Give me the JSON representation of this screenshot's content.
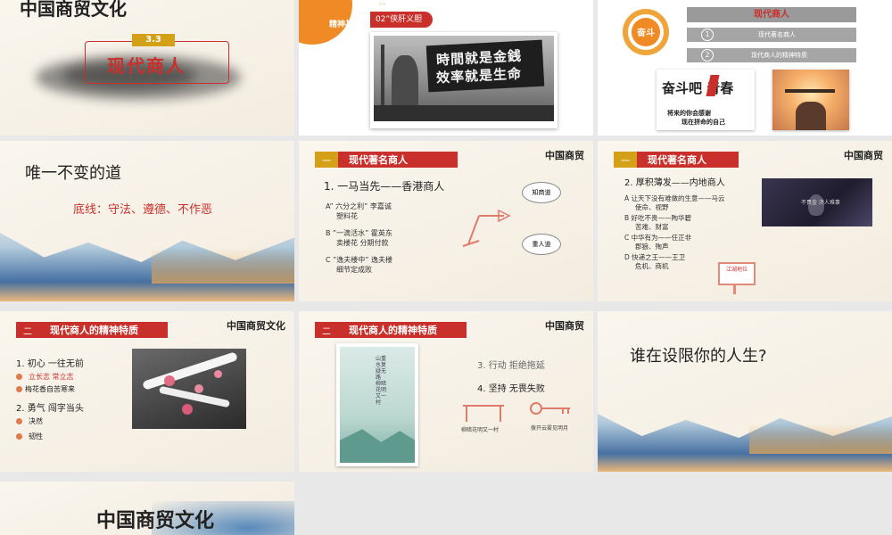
{
  "colors": {
    "red": "#c9302c",
    "gold": "#d4a017",
    "orange": "#f08a24",
    "gray": "#9a9a9a"
  },
  "s1": {
    "logo": "中国商贸文化",
    "badge": "3.3",
    "title": "现代商人"
  },
  "s2": {
    "tab_small": "…",
    "tab_label": "精神基础",
    "section": "02”侠肝义胆",
    "photo_line1": "時間就是金銭",
    "photo_line2": "效率就是生命"
  },
  "s3": {
    "circle_label": "奋斗",
    "menu_title": "现代商人",
    "item1_num": "1",
    "item1": "现代著名商人",
    "item2_num": "2",
    "item2": "现代商人的精神特质",
    "poster_title": "奋斗吧 青春",
    "poster_sub1": "将来的你会感谢",
    "poster_sub2": "现在拼命的自己"
  },
  "s4": {
    "title": "唯一不变的道",
    "subtitle": "底线：守法、遵德、不作恶"
  },
  "s5": {
    "hdr_num": "一",
    "hdr_title": "现代著名商人",
    "logo": "中国商贸",
    "heading": "1. 一马当先——香港商人",
    "a1": "A” 六分之利” 李嘉诚",
    "a2": "塑料花",
    "b1": "B ”一滴活水” 霍英东",
    "b2": "卖楼花 分期付款",
    "c1": "C ”逸夫楼中” 逸夫楼",
    "c2": "细节定成败",
    "bubble1": "知商道",
    "bubble2": "重人道"
  },
  "s6": {
    "hdr_num": "一",
    "hdr_title": "现代著名商人",
    "logo": "中国商贸",
    "heading": "2. 厚积薄发——内地商人",
    "a1": "A  让天下没有难做的生意——马云",
    "a2": "使命、视野",
    "b1": "B  好吃不贵——陶华碧",
    "b2": "苦难、财富",
    "c1": "C  中华有为——任正非",
    "c2": "郡狼、殉声",
    "d1": "D  快递之王——王卫",
    "d2": "危机、商机",
    "video_text": "不畏金  济人难事",
    "sign": "江湖地位"
  },
  "s7": {
    "hdr_num": "二",
    "hdr_title": "现代商人的精神特质",
    "logo": "中国商贸文化",
    "l1": "1. 初心 一往无前",
    "l2": "立长志 常立志",
    "l3": "梅花香自苦寒来",
    "l4": "2. 勇气 闯字当头",
    "l5": "决然",
    "l6": "韧性"
  },
  "s8": {
    "hdr_num": "二",
    "hdr_title": "现代商人的精神特质",
    "logo": "中国商贸",
    "l1": "3. 行动 拒绝拖延",
    "l2": "4. 坚持 无畏失败",
    "cap1": "柳暗花明又一村",
    "cap2": "拨开云雾见明月",
    "poem": "山重水复疑无路 柳暗花明又一村"
  },
  "s9": {
    "title": "谁在设限你的人生?"
  },
  "s10": {
    "logo": "中国商贸文化"
  }
}
